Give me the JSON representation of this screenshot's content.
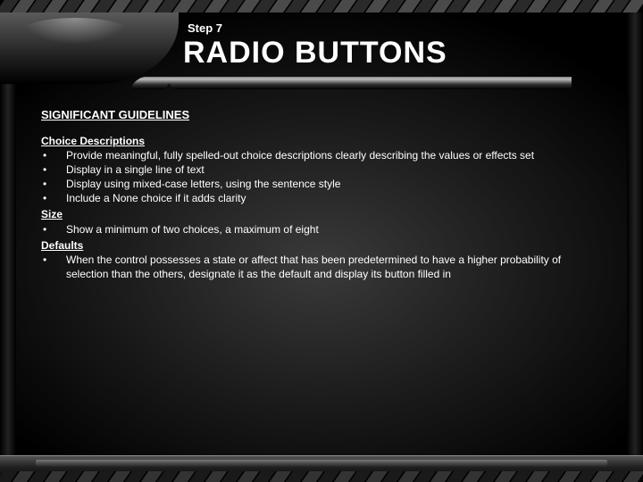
{
  "header": {
    "step": "Step 7",
    "title": "RADIO BUTTONS"
  },
  "section_title": "SIGNIFICANT GUIDELINES",
  "groups": [
    {
      "heading": "Choice Descriptions",
      "items": [
        "Provide meaningful, fully spelled-out choice descriptions clearly describing the values or effects set",
        "Display in a single line of text",
        "Display using mixed-case letters, using the sentence style",
        "Include a None choice if it adds clarity"
      ]
    },
    {
      "heading": "Size",
      "items": [
        "Show a minimum of two choices, a maximum of eight"
      ]
    },
    {
      "heading": "Defaults",
      "items": [
        "When the control possesses a state or affect that has been predetermined to have a higher probability of selection than the others, designate it as the default and display its button filled in"
      ]
    }
  ],
  "bullet_char": "•"
}
